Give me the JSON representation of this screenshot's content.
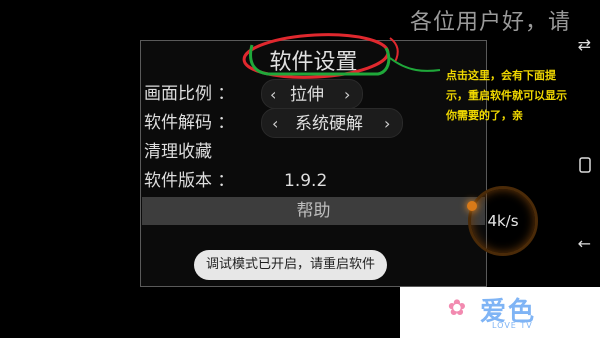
{
  "marquee_text": "各位用户好，请",
  "panel": {
    "title": "软件设置",
    "rows": [
      {
        "label": "画面比例 ：",
        "value": "拉伸",
        "prev": "‹",
        "next": "›"
      },
      {
        "label": "软件解码 ：",
        "value": "系统硬解",
        "prev": "‹",
        "next": "›"
      },
      {
        "label": "清理收藏"
      },
      {
        "label": "软件版本 ：",
        "value": "1.9.2"
      }
    ],
    "help_label": "帮助"
  },
  "toast": "调试模式已开启，请重启软件",
  "speed": "4k/s",
  "annotation": "点击这里，会有下面提示，重启软件就可以显示你需要的了，亲",
  "logo": {
    "brand": "爱色",
    "sub": "LOVE TV"
  },
  "colors": {
    "annotation": "#f0d800",
    "circle": "#e0282e",
    "underline": "#1fa83a"
  }
}
